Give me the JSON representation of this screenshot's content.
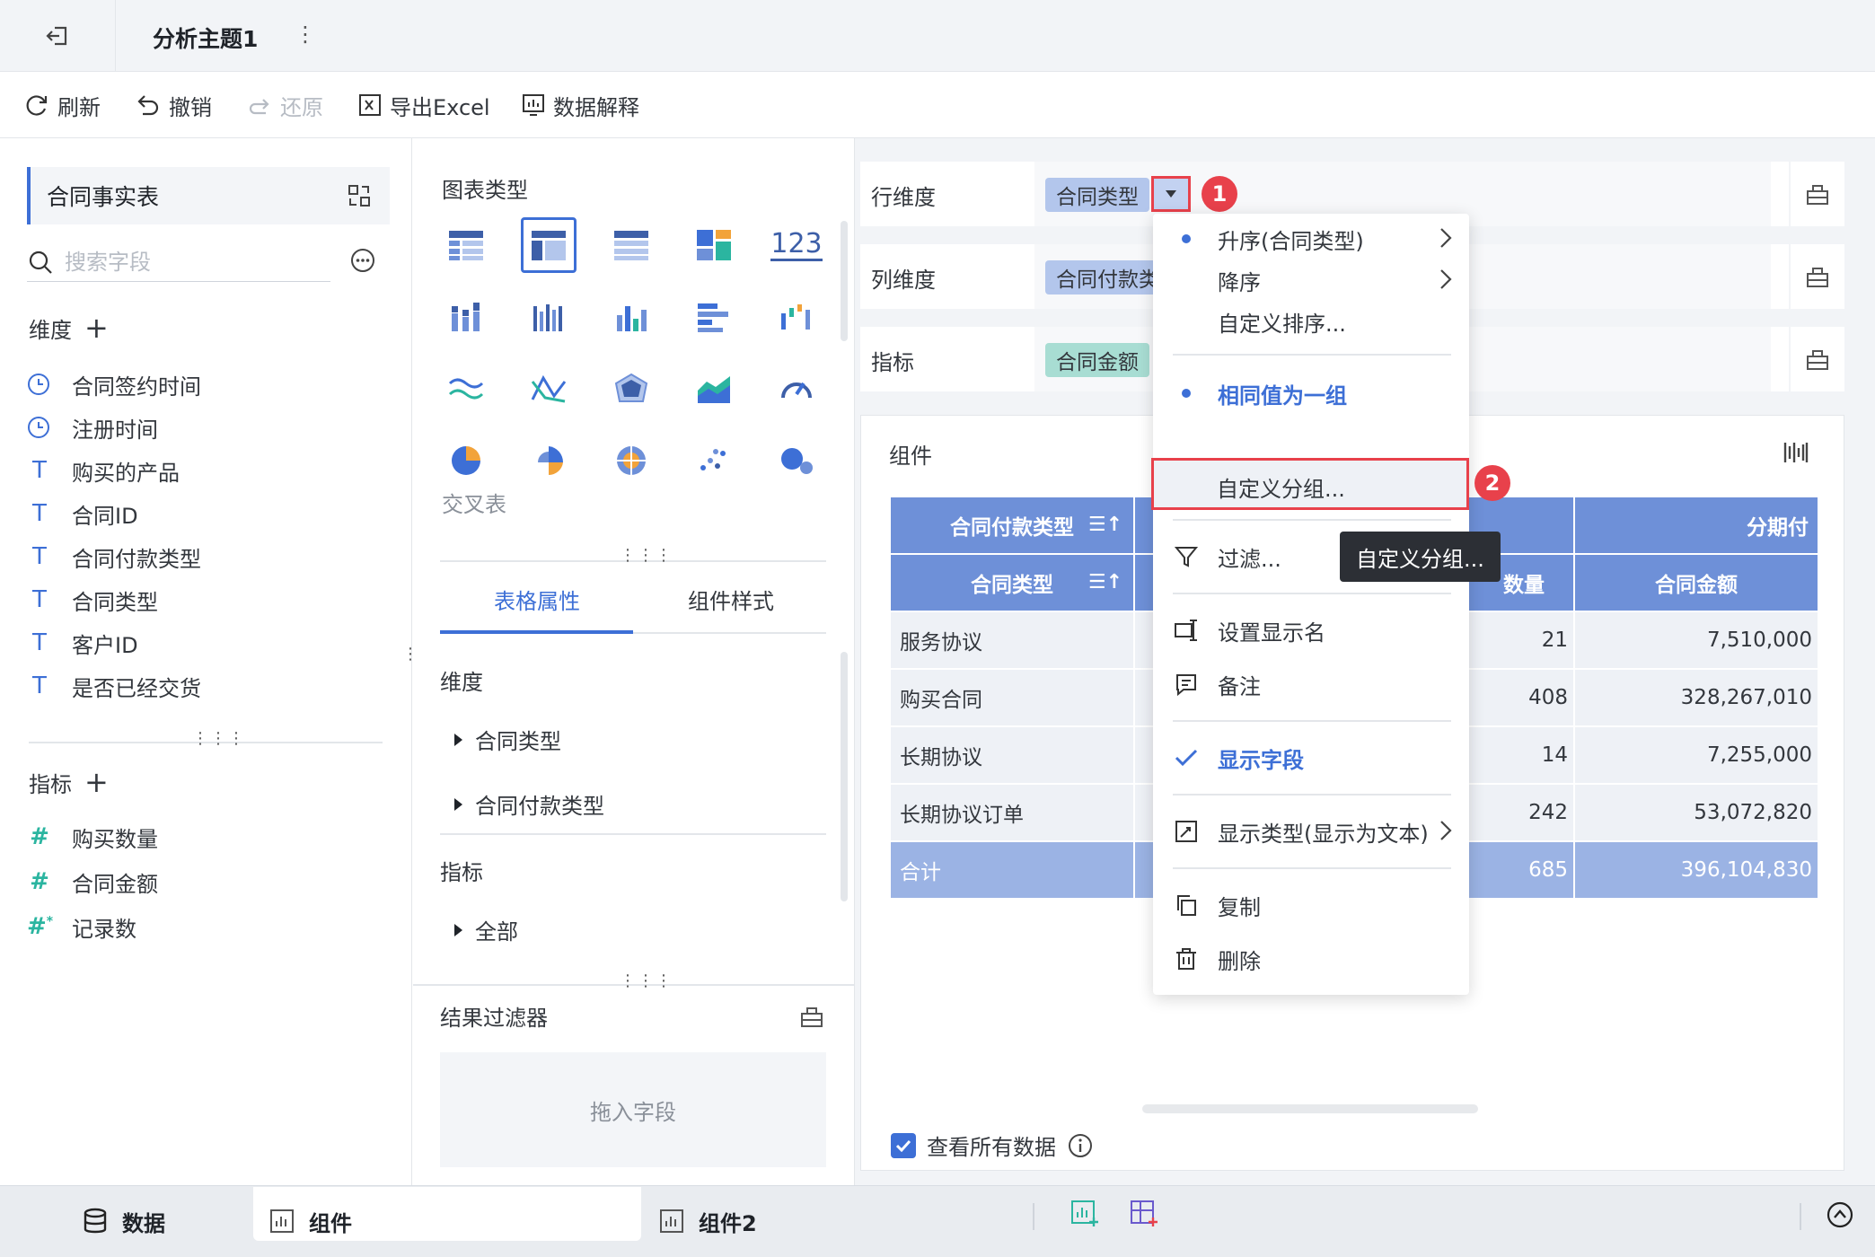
{
  "header": {
    "title": "分析主题1",
    "more": "⋮"
  },
  "toolbar": {
    "refresh": "刷新",
    "undo": "撤销",
    "redo": "还原",
    "export": "导出Excel",
    "explain": "数据解释"
  },
  "left": {
    "dataset": "合同事实表",
    "search_placeholder": "搜索字段",
    "dimension_header": "维度",
    "dimensions": [
      {
        "icon": "clock-icon",
        "label": "合同签约时间"
      },
      {
        "icon": "clock-icon",
        "label": "注册时间"
      },
      {
        "icon": "text-field-icon",
        "label": "购买的产品"
      },
      {
        "icon": "text-field-icon",
        "label": "合同ID"
      },
      {
        "icon": "text-field-icon",
        "label": "合同付款类型"
      },
      {
        "icon": "text-field-icon",
        "label": "合同类型"
      },
      {
        "icon": "text-field-icon",
        "label": "客户ID"
      },
      {
        "icon": "text-field-icon",
        "label": "是否已经交货"
      }
    ],
    "measure_header": "指标",
    "measures": [
      {
        "icon": "hash-icon",
        "label": "购买数量"
      },
      {
        "icon": "hash-icon",
        "label": "合同金额"
      },
      {
        "icon": "hash-star-icon",
        "label": "记录数"
      }
    ],
    "plus": "+"
  },
  "middle": {
    "chart_type_label": "图表类型",
    "crosstab_label": "交叉表",
    "tabs": [
      "表格属性",
      "组件样式"
    ],
    "dimension_header": "维度",
    "dimension_items": [
      "合同类型",
      "合同付款类型"
    ],
    "measure_header": "指标",
    "measure_items": [
      "全部"
    ],
    "result_filter_label": "结果过滤器",
    "drop_placeholder": "拖入字段",
    "kpi_glyph": "123"
  },
  "shelves": {
    "row": {
      "label": "行维度",
      "pill": "合同类型"
    },
    "col": {
      "label": "列维度",
      "pill": "合同付款类型"
    },
    "measure": {
      "label": "指标",
      "pill": "合同金额"
    }
  },
  "component": {
    "title": "组件",
    "table": {
      "header1": {
        "col1": "合同付款类型",
        "col3": "分期付"
      },
      "header2": {
        "col1": "合同类型",
        "col2": "数量",
        "col3": "合同金额"
      },
      "rows": [
        {
          "name": "服务协议",
          "qty": "21",
          "amount": "7,510,000"
        },
        {
          "name": "购买合同",
          "qty": "408",
          "amount": "328,267,010"
        },
        {
          "name": "长期协议",
          "qty": "14",
          "amount": "7,255,000"
        },
        {
          "name": "长期协议订单",
          "qty": "242",
          "amount": "53,072,820"
        }
      ],
      "total": {
        "name": "合计",
        "qty": "685",
        "amount": "396,104,830"
      }
    },
    "view_all": "查看所有数据"
  },
  "menu": {
    "items": [
      {
        "label": "升序(合同类型)",
        "lead": "dot",
        "arrow": true
      },
      {
        "label": "降序",
        "lead": "",
        "arrow": true
      },
      {
        "label": "自定义排序...",
        "lead": "",
        "arrow": false
      },
      {
        "label": "相同值为一组",
        "lead": "dot",
        "arrow": false,
        "selected": true
      },
      {
        "label": "自定义分组...",
        "lead": "",
        "arrow": false
      },
      {
        "label": "过滤...",
        "lead": "filter-icon",
        "arrow": false
      },
      {
        "label": "设置显示名",
        "lead": "rename-icon",
        "arrow": false
      },
      {
        "label": "备注",
        "lead": "comment-icon",
        "arrow": false
      },
      {
        "label": "显示字段",
        "lead": "check-icon",
        "arrow": false,
        "selected": true
      },
      {
        "label": "显示类型(显示为文本)",
        "lead": "display-type-icon",
        "arrow": true
      },
      {
        "label": "复制",
        "lead": "copy-icon",
        "arrow": false
      },
      {
        "label": "删除",
        "lead": "trash-icon",
        "arrow": false
      }
    ],
    "tooltip": "自定义分组..."
  },
  "badges": [
    "1",
    "2"
  ],
  "bottom": {
    "data_tab": "数据",
    "tabs": [
      "组件",
      "组件2"
    ]
  },
  "colors": {
    "accent": "#3d6fd6",
    "highlight": "#e8414b",
    "header_blue": "#6e90d8",
    "measure_green": "#a8ddd3"
  }
}
